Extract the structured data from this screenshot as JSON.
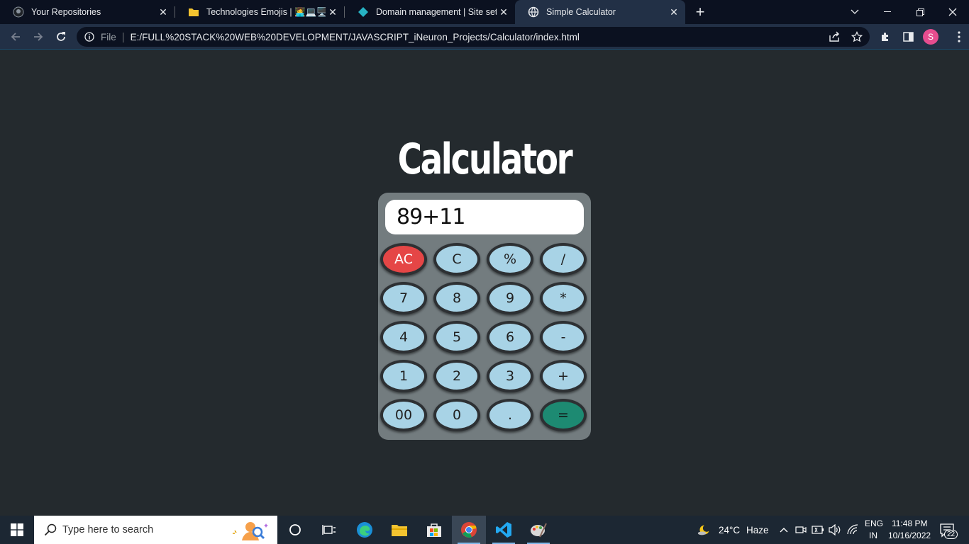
{
  "browser": {
    "tabs": [
      {
        "title": "Your Repositories",
        "icon": "github-icon",
        "active": false
      },
      {
        "title": "Technologies Emojis | 👩‍💻💻🖥️⚒️",
        "icon": "folder-icon",
        "active": false
      },
      {
        "title": "Domain management | Site settin",
        "icon": "domain-diamond-icon",
        "active": false
      },
      {
        "title": "Simple Calculator",
        "icon": "globe-icon",
        "active": true
      }
    ],
    "new_tab_label": "+",
    "address": {
      "scheme_label": "File",
      "url": "E:/FULL%20STACK%20WEB%20DEVELOPMENT/JAVASCRIPT_iNeuron_Projects/Calculator/index.html"
    },
    "profile_initial": "S"
  },
  "calculator": {
    "title": "Calculator",
    "display_value": "89+11",
    "keys": [
      {
        "label": "AC",
        "kind": "clear-all"
      },
      {
        "label": "C",
        "kind": "clear"
      },
      {
        "label": "%",
        "kind": "operator"
      },
      {
        "label": "/",
        "kind": "operator"
      },
      {
        "label": "7",
        "kind": "digit"
      },
      {
        "label": "8",
        "kind": "digit"
      },
      {
        "label": "9",
        "kind": "digit"
      },
      {
        "label": "*",
        "kind": "operator"
      },
      {
        "label": "4",
        "kind": "digit"
      },
      {
        "label": "5",
        "kind": "digit"
      },
      {
        "label": "6",
        "kind": "digit"
      },
      {
        "label": "-",
        "kind": "operator"
      },
      {
        "label": "1",
        "kind": "digit"
      },
      {
        "label": "2",
        "kind": "digit"
      },
      {
        "label": "3",
        "kind": "digit"
      },
      {
        "label": "+",
        "kind": "operator"
      },
      {
        "label": "00",
        "kind": "digit"
      },
      {
        "label": "0",
        "kind": "digit"
      },
      {
        "label": ".",
        "kind": "decimal"
      },
      {
        "label": "=",
        "kind": "equals"
      }
    ],
    "colors": {
      "key": "#a8d3e6",
      "clear_all": "#e54646",
      "equals": "#1d8a72",
      "body": "#737c7f"
    }
  },
  "taskbar": {
    "search_placeholder": "Type here to search",
    "weather": {
      "temp": "24°C",
      "condition": "Haze"
    },
    "language": {
      "lang": "ENG",
      "region": "IN"
    },
    "clock": {
      "time": "11:48 PM",
      "date": "10/16/2022"
    },
    "notification_count": "22"
  }
}
